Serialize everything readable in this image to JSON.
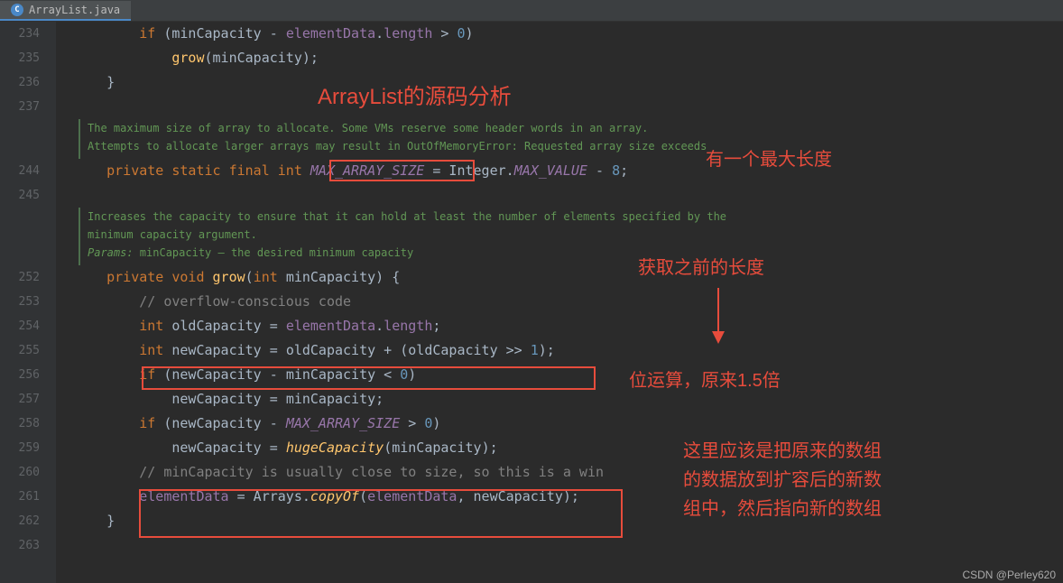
{
  "tab": {
    "filename": "ArrayList.java",
    "icon_letter": "C"
  },
  "gutter": {
    "line_numbers": [
      "234",
      "235",
      "236",
      "237",
      "",
      "",
      "244",
      "245",
      "",
      "",
      "",
      "252",
      "253",
      "254",
      "255",
      "256",
      "257",
      "258",
      "259",
      "260",
      "261",
      "262",
      "263"
    ]
  },
  "jdoc1": {
    "line1": "The maximum size of array to allocate. Some VMs reserve some header words in an array.",
    "line2": "Attempts to allocate larger arrays may result in OutOfMemoryError: Requested array size exceeds"
  },
  "jdoc2": {
    "line1": "Increases the capacity to ensure that it can hold at least the number of elements specified by the",
    "line2": "minimum capacity argument.",
    "params_label": " Params: ",
    "param_name": "minCapacity",
    "param_desc": " – the desired minimum capacity"
  },
  "code": {
    "l234_if": "if",
    "l234_minCap": "minCapacity",
    "l234_elemData": "elementData",
    "l234_length": "length",
    "l235_grow": "grow",
    "l235_minCap": "minCapacity",
    "l244_private": "private static final int",
    "l244_max": "MAX_ARRAY_SIZE",
    "l244_eq": " = Integer.",
    "l244_maxval": "MAX_VALUE",
    "l244_minus": " - ",
    "l244_eight": "8",
    "l252_private": "private void",
    "l252_grow": "grow",
    "l252_int": "int",
    "l252_param": "minCapacity",
    "l253_comment": "// overflow-conscious code",
    "l254_int": "int",
    "l254_old": "oldCapacity",
    "l254_eq": " = ",
    "l254_elem": "elementData",
    "l254_len": "length",
    "l255_int": "int",
    "l255_new": "newCapacity",
    "l255_eq": " = ",
    "l255_old": "oldCapacity",
    "l255_plus": " + (",
    "l255_old2": "oldCapacity",
    "l255_shift": " >> ",
    "l255_one": "1",
    "l256_if": "if",
    "l256_new": "newCapacity",
    "l256_minus": " - ",
    "l256_min": "minCapacity",
    "l256_lt": " < ",
    "l256_zero": "0",
    "l257_new": "newCapacity",
    "l257_eq": " = ",
    "l257_min": "minCapacity",
    "l258_if": "if",
    "l258_new": "newCapacity",
    "l258_minus": " - ",
    "l258_max": "MAX_ARRAY_SIZE",
    "l258_gt": " > ",
    "l258_zero": "0",
    "l259_new": "newCapacity",
    "l259_eq": " = ",
    "l259_huge": "hugeCapacity",
    "l259_min": "minCapacity",
    "l260_comment": "// minCapacity is usually close to size, so this is a win",
    "l261_elem": "elementData",
    "l261_eq": " = Arrays.",
    "l261_copy": "copyOf",
    "l261_elem2": "elementData",
    "l261_new": "newCapacity"
  },
  "annotations": {
    "title": "ArrayList的源码分析",
    "max_len": "有一个最大长度",
    "get_prev": "获取之前的长度",
    "bitop": "位运算，原来1.5倍",
    "copy1": "这里应该是把原来的数组",
    "copy2": "的数据放到扩容后的新数",
    "copy3": "组中，然后指向新的数组"
  },
  "watermark": "CSDN @Perley620"
}
